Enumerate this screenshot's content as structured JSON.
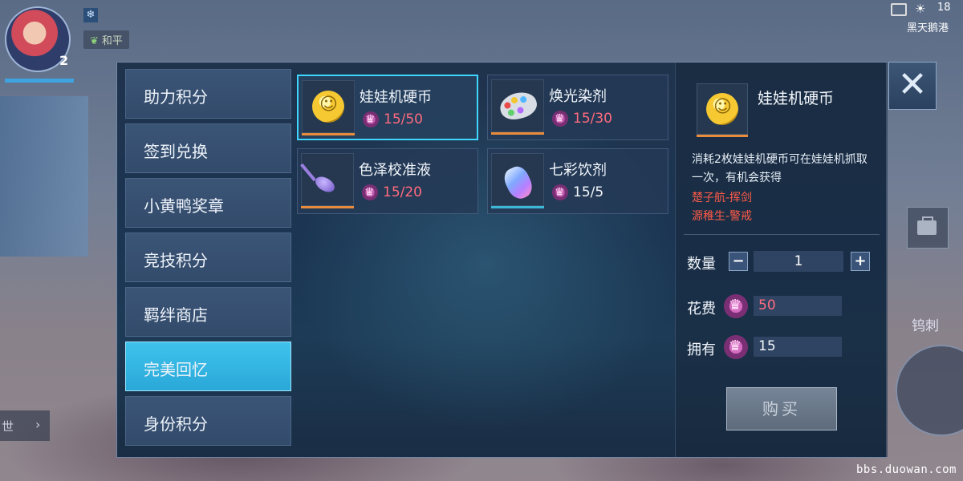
{
  "hud": {
    "level": "2",
    "mode_badge": "和平",
    "map_name": "黑天鹅港",
    "time_partial": "18",
    "chat_label": "世",
    "right_text": "钨刺"
  },
  "watermark": "bbs.duowan.com",
  "shop": {
    "close_label": "✕",
    "categories": [
      {
        "label": "助力积分",
        "active": false
      },
      {
        "label": "签到兑换",
        "active": false
      },
      {
        "label": "小黄鸭奖章",
        "active": false
      },
      {
        "label": "竞技积分",
        "active": false
      },
      {
        "label": "羁绊商店",
        "active": false
      },
      {
        "label": "完美回忆",
        "active": true
      },
      {
        "label": "身份积分",
        "active": false
      }
    ],
    "items": [
      {
        "name": "娃娃机硬币",
        "price": "15/50",
        "icon": "coin-icon",
        "selected": true,
        "price_color": "#ff6b7e",
        "bar": "orange"
      },
      {
        "name": "焕光染剂",
        "price": "15/30",
        "icon": "palette-icon",
        "selected": false,
        "price_color": "#ff6b7e",
        "bar": "orange"
      },
      {
        "name": "色泽校准液",
        "price": "15/20",
        "icon": "purple-vial-icon",
        "selected": false,
        "price_color": "#ff6b7e",
        "bar": "orange"
      },
      {
        "name": "七彩饮剂",
        "price": "15/5",
        "icon": "rainbow-potion-icon",
        "selected": false,
        "price_color": "#f3f6fa",
        "bar": "blue"
      }
    ],
    "detail": {
      "title": "娃娃机硬币",
      "description": "消耗2枚娃娃机硬币可在娃娃机抓取一次，有机会获得",
      "rewards": [
        "楚子航-挥剑",
        "源稚生-警戒"
      ],
      "quantity_label": "数量",
      "quantity_value": "1",
      "minus_label": "−",
      "plus_label": "+",
      "cost_label": "花费",
      "cost_value": "50",
      "own_label": "拥有",
      "own_value": "15",
      "buy_label": "购买"
    }
  },
  "colors": {
    "accent": "#3ec3ec",
    "price_insufficient": "#ff6b7e",
    "reward_text": "#ff5a47"
  }
}
